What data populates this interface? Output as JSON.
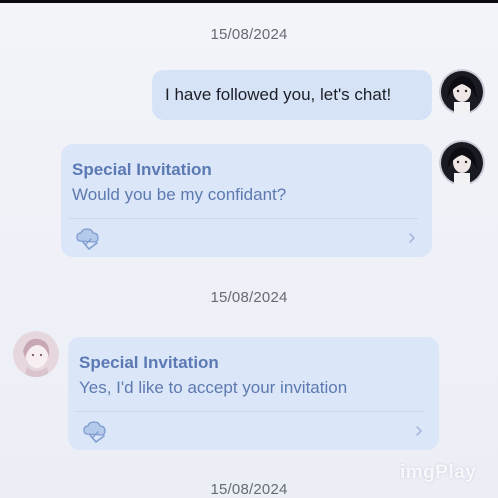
{
  "messages": {
    "timestamp_1": "15/08/2024",
    "timestamp_2": "15/08/2024",
    "timestamp_3": "15/08/2024",
    "outgoing_text": "I have followed you, let's chat!",
    "invitation_1": {
      "title": "Special Invitation",
      "body": "Would you be my confidant?"
    },
    "invitation_2": {
      "title": "Special Invitation",
      "body": "Yes, I'd like to accept your invitation"
    }
  },
  "watermark": "imgPlay",
  "icons": {
    "invitation_card": "cloud-hand-icon",
    "card_action": "chevron-right-icon",
    "user_avatar": "avatar",
    "contact_avatar": "avatar"
  },
  "colors": {
    "bubble": "#d6e3f7",
    "card": "#dbe6f8",
    "card_accent": "#5b79b3",
    "timestamp": "#666a74"
  }
}
